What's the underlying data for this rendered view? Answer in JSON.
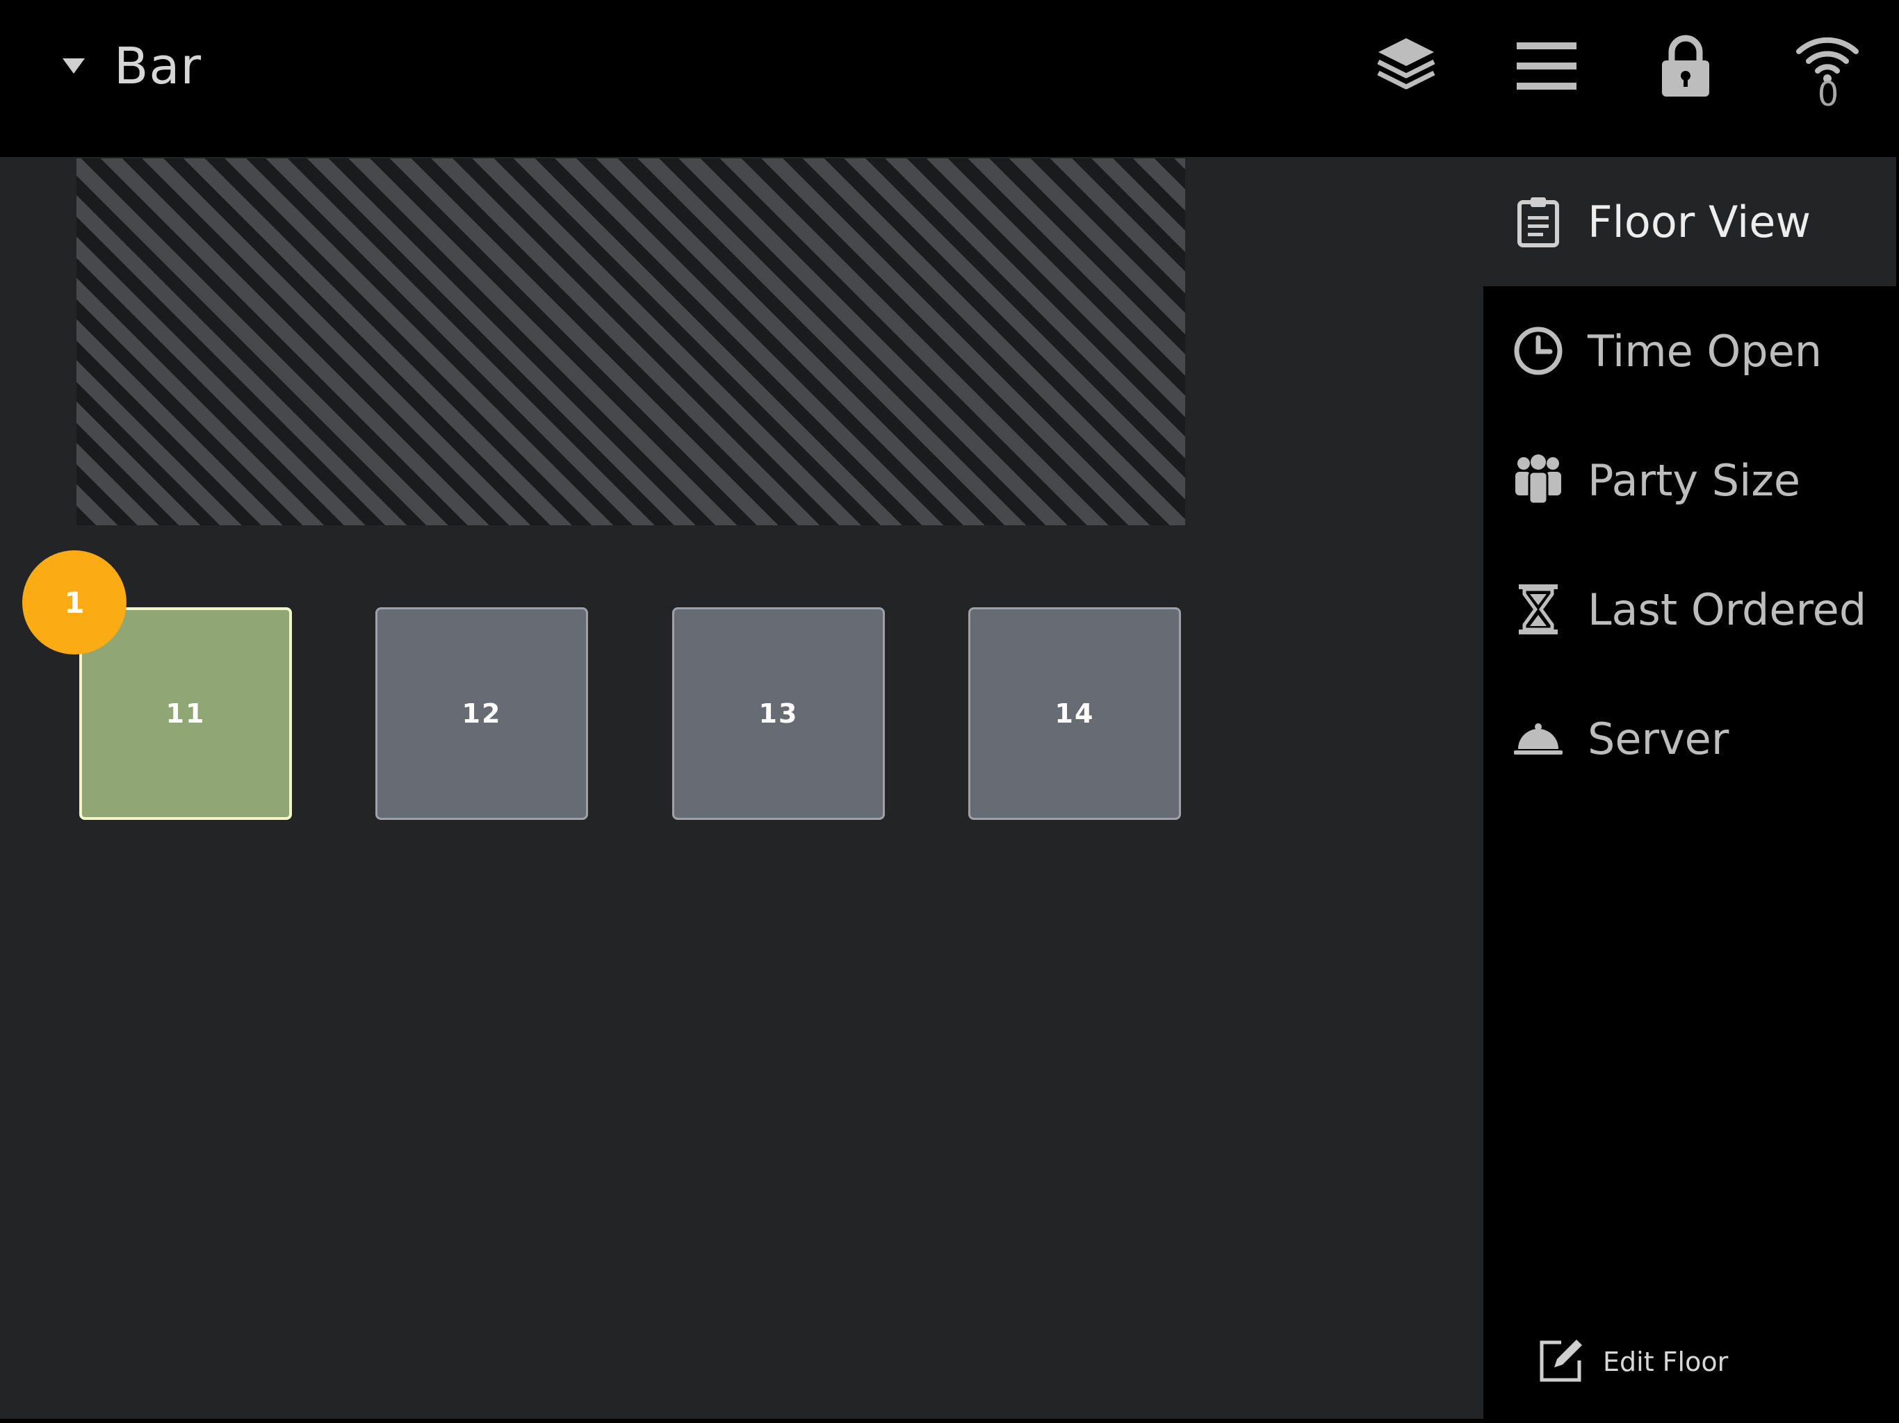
{
  "header": {
    "area_title": "Bar",
    "wifi_count": "0"
  },
  "floor": {
    "tables": [
      {
        "number": "11",
        "status": "open",
        "party_size": "1"
      },
      {
        "number": "12",
        "status": "free"
      },
      {
        "number": "13",
        "status": "free"
      },
      {
        "number": "14",
        "status": "free"
      }
    ]
  },
  "side_panel": {
    "items": [
      {
        "label": "Floor View",
        "icon": "clipboard-icon",
        "active": true
      },
      {
        "label": "Time Open",
        "icon": "clock-icon"
      },
      {
        "label": "Party Size",
        "icon": "people-icon"
      },
      {
        "label": "Last Ordered",
        "icon": "hourglass-icon"
      },
      {
        "label": "Server",
        "icon": "cloche-icon"
      }
    ],
    "edit_floor_label": "Edit Floor"
  },
  "colors": {
    "open_table": "#91a675",
    "free_table": "#676b72",
    "badge": "#fbab14",
    "floor_bg": "#232426"
  }
}
